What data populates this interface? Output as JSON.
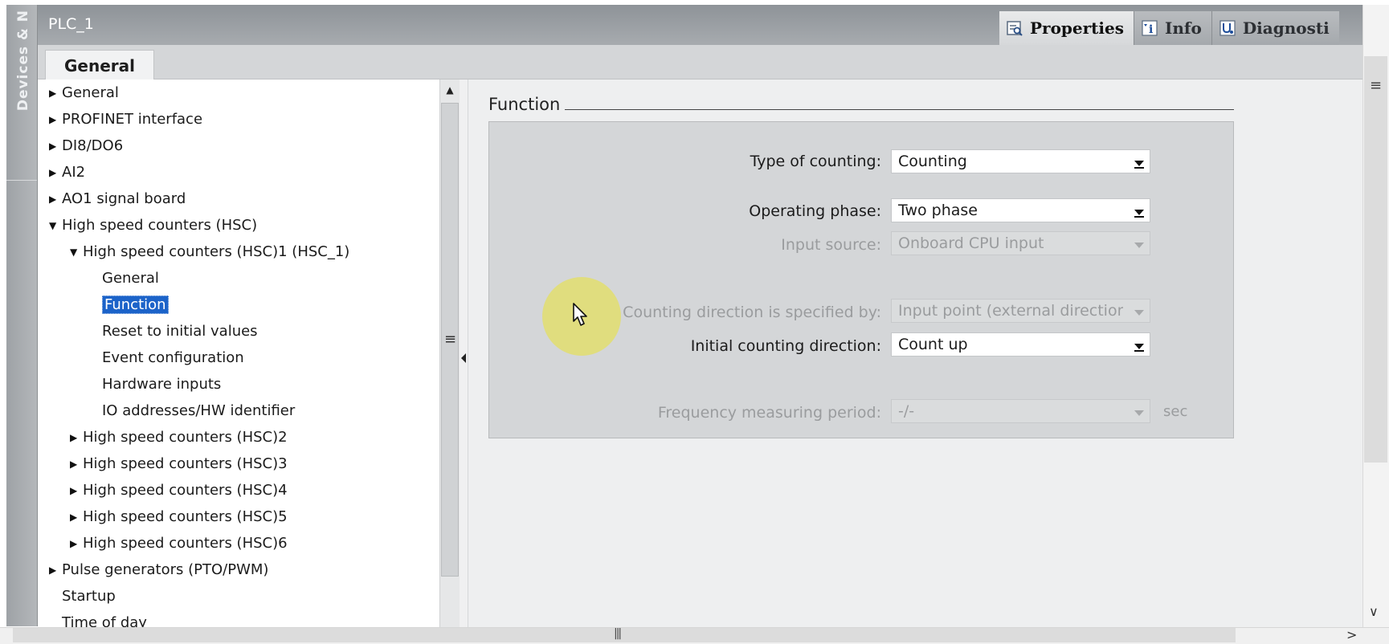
{
  "side_panel": {
    "label": "Devices & N"
  },
  "header": {
    "title": "PLC_1",
    "tabs": [
      {
        "label": "Properties",
        "icon": "properties-icon",
        "active": true
      },
      {
        "label": "Info",
        "icon": "info-icon",
        "active": false
      },
      {
        "label": "Diagnosti",
        "icon": "diagnostics-icon",
        "active": false
      }
    ]
  },
  "subtabs": {
    "general": "General"
  },
  "tree": {
    "items": [
      {
        "label": "General",
        "indent": 0,
        "state": "collapsed"
      },
      {
        "label": "PROFINET interface",
        "indent": 0,
        "state": "collapsed"
      },
      {
        "label": "DI8/DO6",
        "indent": 0,
        "state": "collapsed"
      },
      {
        "label": "AI2",
        "indent": 0,
        "state": "collapsed"
      },
      {
        "label": "AO1 signal board",
        "indent": 0,
        "state": "collapsed"
      },
      {
        "label": "High speed counters (HSC)",
        "indent": 0,
        "state": "expanded"
      },
      {
        "label": "High speed counters (HSC)1 (HSC_1)",
        "indent": 1,
        "state": "expanded"
      },
      {
        "label": "General",
        "indent": 2,
        "state": "leaf"
      },
      {
        "label": "Function",
        "indent": 2,
        "state": "leaf",
        "selected": true
      },
      {
        "label": "Reset to initial values",
        "indent": 2,
        "state": "leaf"
      },
      {
        "label": "Event configuration",
        "indent": 2,
        "state": "leaf"
      },
      {
        "label": "Hardware inputs",
        "indent": 2,
        "state": "leaf"
      },
      {
        "label": "IO addresses/HW identifier",
        "indent": 2,
        "state": "leaf"
      },
      {
        "label": "High speed counters (HSC)2",
        "indent": 1,
        "state": "collapsed"
      },
      {
        "label": "High speed counters (HSC)3",
        "indent": 1,
        "state": "collapsed"
      },
      {
        "label": "High speed counters (HSC)4",
        "indent": 1,
        "state": "collapsed"
      },
      {
        "label": "High speed counters (HSC)5",
        "indent": 1,
        "state": "collapsed"
      },
      {
        "label": "High speed counters (HSC)6",
        "indent": 1,
        "state": "collapsed"
      },
      {
        "label": "Pulse generators (PTO/PWM)",
        "indent": 0,
        "state": "collapsed"
      },
      {
        "label": "Startup",
        "indent": 0,
        "state": "leaf"
      },
      {
        "label": "Time of day",
        "indent": 0,
        "state": "leaf"
      }
    ]
  },
  "section": {
    "title": "Function",
    "fields": [
      {
        "label": "Type of counting:",
        "value": "Counting",
        "enabled": true
      },
      {
        "label": "Operating phase:",
        "value": "Two phase",
        "enabled": true
      },
      {
        "label": "Input source:",
        "value": "Onboard CPU input",
        "enabled": false
      },
      {
        "label": "Counting direction is specified by:",
        "value": "Input point (external direction",
        "enabled": false
      },
      {
        "label": "Initial counting direction:",
        "value": "Count up",
        "enabled": true
      },
      {
        "label": "Frequency measuring period:",
        "value": "-/-",
        "enabled": false,
        "unit": "sec"
      }
    ]
  },
  "colors": {
    "selection": "#1c63c9",
    "cursor_highlight": "#e2de6e",
    "header_bar": "#9a9ea2"
  }
}
